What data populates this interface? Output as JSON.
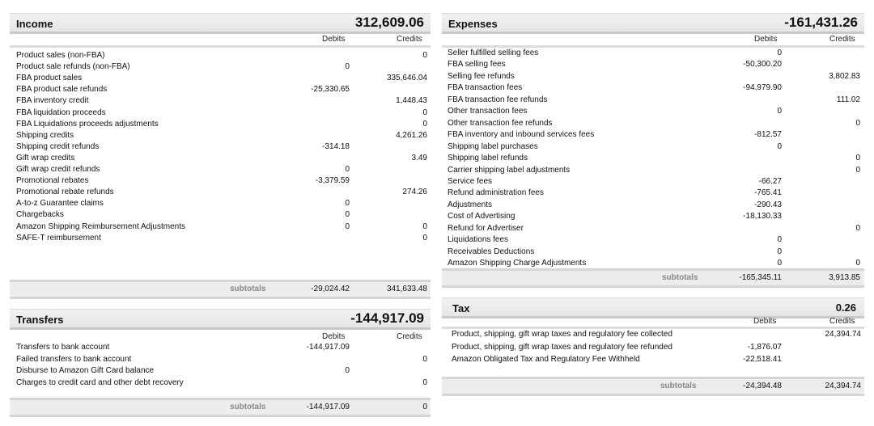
{
  "income": {
    "title": "Income",
    "total": "312,609.06",
    "debits_label": "Debits",
    "credits_label": "Credits",
    "rows": [
      {
        "label": "Product sales (non-FBA)",
        "debit": "",
        "credit": "0"
      },
      {
        "label": "Product sale refunds (non-FBA)",
        "debit": "0",
        "credit": ""
      },
      {
        "label": "FBA product sales",
        "debit": "",
        "credit": "335,646.04"
      },
      {
        "label": "FBA product sale refunds",
        "debit": "-25,330.65",
        "credit": ""
      },
      {
        "label": "FBA inventory credit",
        "debit": "",
        "credit": "1,448.43"
      },
      {
        "label": "FBA liquidation proceeds",
        "debit": "",
        "credit": "0"
      },
      {
        "label": "FBA Liquidations proceeds adjustments",
        "debit": "",
        "credit": "0"
      },
      {
        "label": "Shipping credits",
        "debit": "",
        "credit": "4,261.26"
      },
      {
        "label": "Shipping credit refunds",
        "debit": "-314.18",
        "credit": ""
      },
      {
        "label": "Gift wrap credits",
        "debit": "",
        "credit": "3.49"
      },
      {
        "label": "Gift wrap credit refunds",
        "debit": "0",
        "credit": ""
      },
      {
        "label": "Promotional rebates",
        "debit": "-3,379.59",
        "credit": ""
      },
      {
        "label": "Promotional rebate refunds",
        "debit": "",
        "credit": "274.26"
      },
      {
        "label": "A-to-z Guarantee claims",
        "debit": "0",
        "credit": ""
      },
      {
        "label": "Chargebacks",
        "debit": "0",
        "credit": ""
      },
      {
        "label": "Amazon Shipping Reimbursement Adjustments",
        "debit": "0",
        "credit": "0"
      },
      {
        "label": "SAFE-T reimbursement",
        "debit": "",
        "credit": "0"
      }
    ],
    "subtotals_label": "subtotals",
    "subtotal_debit": "-29,024.42",
    "subtotal_credit": "341,633.48"
  },
  "transfers": {
    "title": "Transfers",
    "total": "-144,917.09",
    "debits_label": "Debits",
    "credits_label": "Credits",
    "rows": [
      {
        "label": "Transfers to bank account",
        "debit": "-144,917.09",
        "credit": ""
      },
      {
        "label": "Failed transfers to bank account",
        "debit": "",
        "credit": "0"
      },
      {
        "label": "Disburse to Amazon Gift Card balance",
        "debit": "0",
        "credit": ""
      },
      {
        "label": "Charges to credit card and other debt recovery",
        "debit": "",
        "credit": "0"
      }
    ],
    "subtotals_label": "subtotals",
    "subtotal_debit": "-144,917.09",
    "subtotal_credit": "0"
  },
  "expenses": {
    "title": "Expenses",
    "total": "-161,431.26",
    "debits_label": "Debits",
    "credits_label": "Credits",
    "rows": [
      {
        "label": "Seller fulfilled selling fees",
        "debit": "0",
        "credit": ""
      },
      {
        "label": "FBA selling fees",
        "debit": "-50,300.20",
        "credit": ""
      },
      {
        "label": "Selling fee refunds",
        "debit": "",
        "credit": "3,802.83"
      },
      {
        "label": "FBA transaction fees",
        "debit": "-94,979.90",
        "credit": ""
      },
      {
        "label": "FBA transaction fee refunds",
        "debit": "",
        "credit": "111.02"
      },
      {
        "label": "Other transaction fees",
        "debit": "0",
        "credit": ""
      },
      {
        "label": "Other transaction fee refunds",
        "debit": "",
        "credit": "0"
      },
      {
        "label": "FBA inventory and inbound services fees",
        "debit": "-812.57",
        "credit": ""
      },
      {
        "label": "Shipping label purchases",
        "debit": "0",
        "credit": ""
      },
      {
        "label": "Shipping label refunds",
        "debit": "",
        "credit": "0"
      },
      {
        "label": "Carrier shipping label adjustments",
        "debit": "",
        "credit": "0"
      },
      {
        "label": "Service fees",
        "debit": "-66.27",
        "credit": ""
      },
      {
        "label": "Refund administration fees",
        "debit": "-765.41",
        "credit": ""
      },
      {
        "label": "Adjustments",
        "debit": "-290.43",
        "credit": ""
      },
      {
        "label": "Cost of Advertising",
        "debit": "-18,130.33",
        "credit": ""
      },
      {
        "label": "Refund for Advertiser",
        "debit": "",
        "credit": "0"
      },
      {
        "label": "Liquidations fees",
        "debit": "0",
        "credit": ""
      },
      {
        "label": "Receivables Deductions",
        "debit": "0",
        "credit": ""
      },
      {
        "label": "Amazon Shipping Charge Adjustments",
        "debit": "0",
        "credit": "0"
      }
    ],
    "subtotals_label": "subtotals",
    "subtotal_debit": "-165,345.11",
    "subtotal_credit": "3,913.85"
  },
  "tax": {
    "title": "Tax",
    "total": "0.26",
    "debits_label": "Debits",
    "credits_label": "Credits",
    "rows": [
      {
        "label": "Product, shipping, gift wrap taxes and regulatory fee collected",
        "debit": "",
        "credit": "24,394.74"
      },
      {
        "label": "Product, shipping, gift wrap taxes and regulatory fee refunded",
        "debit": "-1,876.07",
        "credit": ""
      },
      {
        "label": "Amazon Obligated Tax and Regulatory Fee Withheld",
        "debit": "-22,518.41",
        "credit": ""
      }
    ],
    "subtotals_label": "subtotals",
    "subtotal_debit": "-24,394.48",
    "subtotal_credit": "24,394.74"
  }
}
